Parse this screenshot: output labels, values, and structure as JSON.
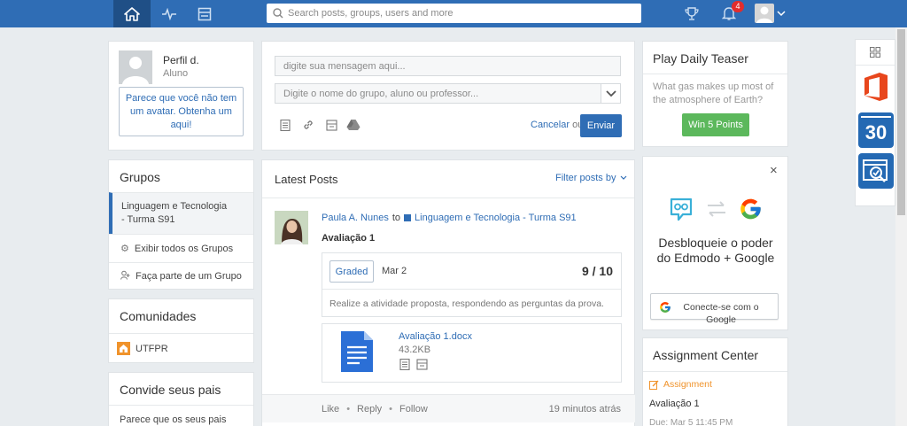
{
  "colors": {
    "brand": "#2f6db5",
    "success": "#5cb85c",
    "assignment_accent": "#f0932b",
    "notification_badge": "#e22d2d"
  },
  "topbar": {
    "icons": [
      "home-icon",
      "activity-icon",
      "planner-icon",
      "trophy-icon",
      "bell-icon",
      "user-avatar",
      "chevron-down-icon"
    ],
    "search_placeholder": "Search posts, groups, users and more",
    "notification_count": "4"
  },
  "profile": {
    "name": "Perfil d.",
    "role": "Aluno",
    "avatar_hint": "Parece que você não tem um avatar. Obtenha um aqui!"
  },
  "groups": {
    "title": "Grupos",
    "items": [
      "Linguagem e Tecnologia - Turma S91",
      "Exibir todos os Grupos",
      "Faça parte de um Grupo"
    ]
  },
  "communities": {
    "title": "Comunidades",
    "items": [
      "UTFPR"
    ]
  },
  "invite": {
    "title": "Convide seus pais",
    "text": "Parece que os seus pais ainda"
  },
  "composer": {
    "message_placeholder": "digite sua mensagem aqui...",
    "recipient_placeholder": "Digite o nome do grupo, aluno ou professor...",
    "cancel_label": "Cancelar",
    "or_label": "ou",
    "send_label": "Enviar"
  },
  "feed": {
    "title": "Latest Posts",
    "filter_label": "Filter posts by",
    "post": {
      "author": "Paula A. Nunes",
      "to_label": "to",
      "group": "Linguagem e Tecnologia - Turma S91",
      "title": "Avaliação 1",
      "status": "Graded",
      "date": "Mar 2",
      "score": "9 / 10",
      "description": "Realize a atividade proposta, respondendo as perguntas da prova.",
      "attachment_name": "Avaliação 1.docx",
      "attachment_size": "43.2KB",
      "actions": [
        "Like",
        "Reply",
        "Follow"
      ],
      "time_ago": "19 minutos atrás"
    }
  },
  "teaser": {
    "title": "Play Daily Teaser",
    "question": "What gas makes up most of the atmosphere of Earth?",
    "button_label": "Win 5 Points"
  },
  "google_promo": {
    "close_label": "×",
    "heading": "Desbloqueie o poder do Edmodo + Google",
    "button_label": "Conecte-se com o Google"
  },
  "assignment_center": {
    "title": "Assignment Center",
    "section_label": "Assignment",
    "item_title": "Avaliação 1",
    "due": "Due: Mar 5 11:45 PM"
  },
  "dock": {
    "apps": [
      "apps-grid-icon",
      "office-icon",
      "calendar-icon",
      "quiz-icon"
    ],
    "calendar_number": "30"
  }
}
